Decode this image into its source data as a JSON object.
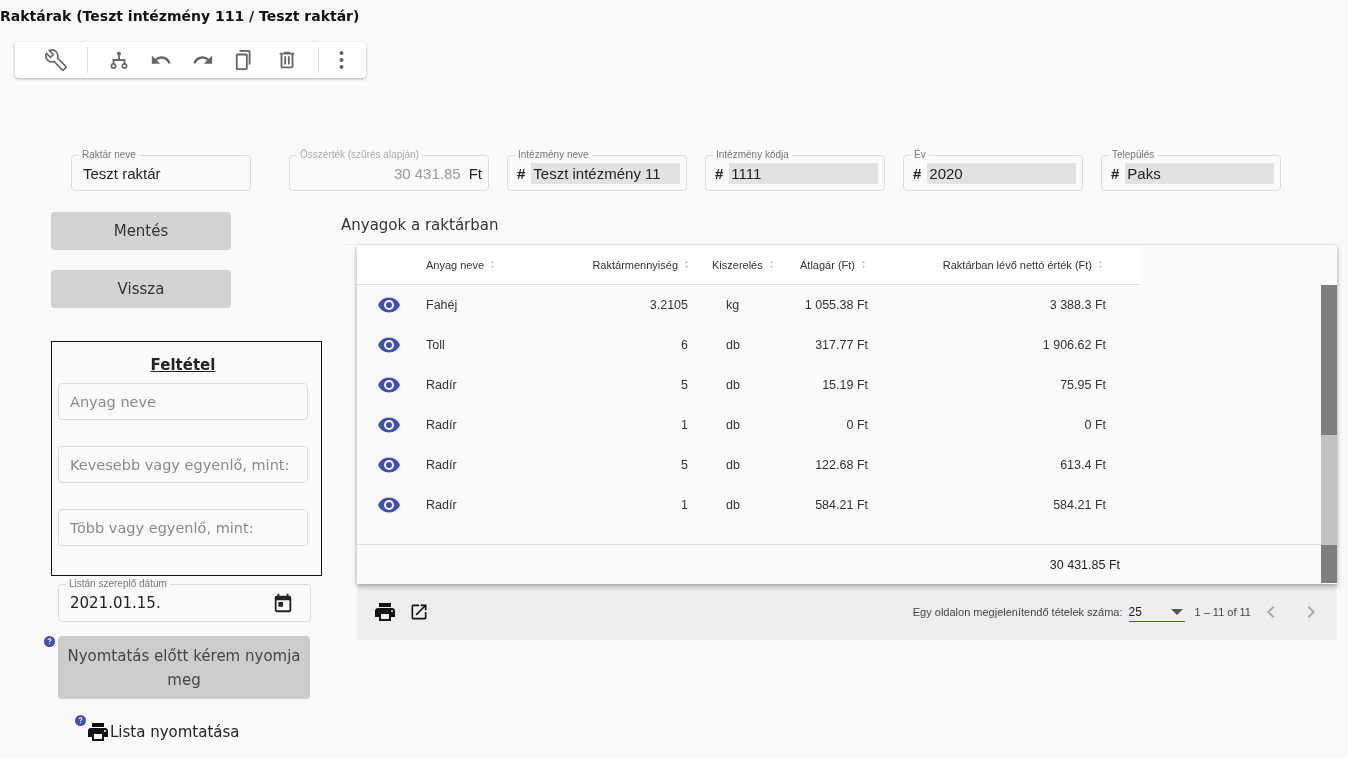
{
  "title": "Raktárak (Teszt intézmény 111 / Teszt raktár)",
  "fields": [
    {
      "kind": "text",
      "label": "Raktár neve",
      "value": "Teszt raktár",
      "readonly": false,
      "disabled": false
    },
    {
      "kind": "total",
      "label": "Összérték (szűrés alapján)",
      "value": "30 431.85",
      "suffix": "Ft",
      "readonly": false,
      "disabled": true
    },
    {
      "kind": "text",
      "label": "Intézmény neve",
      "prefix": "#",
      "value": "Teszt intézmény 11",
      "readonly": true,
      "disabled": false
    },
    {
      "kind": "text",
      "label": "Intézmény kódja",
      "prefix": "#",
      "value": "1111",
      "readonly": true,
      "disabled": false
    },
    {
      "kind": "text",
      "label": "Év",
      "prefix": "#",
      "value": "2020",
      "readonly": true,
      "disabled": false
    },
    {
      "kind": "text",
      "label": "Település",
      "prefix": "#",
      "value": "Paks",
      "readonly": true,
      "disabled": false
    }
  ],
  "buttons": [
    {
      "label": "Mentés"
    },
    {
      "label": "Vissza"
    }
  ],
  "filter": {
    "title": "Feltétel",
    "fields": [
      {
        "placeholder": "Anyag neve"
      },
      {
        "placeholder": "Kevesebb vagy egyenlő, mint:"
      },
      {
        "placeholder": "Több vagy egyenlő, mint:"
      }
    ]
  },
  "date_field": {
    "label": "Listán szereplő dátum",
    "value": "2021.01.15."
  },
  "print_prepare_button": {
    "label": "Nyomtatás előtt kérem nyomja meg"
  },
  "print_list_link": {
    "label": "Lista nyomtatása"
  },
  "table": {
    "heading": "Anyagok a raktárban",
    "columns": [
      {
        "label": "Anyag neve"
      },
      {
        "label": "Raktármennyiség"
      },
      {
        "label": "Kiszerelés"
      },
      {
        "label": "Átlagár (Ft)"
      },
      {
        "label": "Raktárban lévő nettó érték (Ft)"
      }
    ],
    "rows": [
      {
        "cells": [
          "Fahéj",
          "3.2105",
          "kg",
          "1 055.38 Ft",
          "3 388.3 Ft"
        ]
      },
      {
        "cells": [
          "Toll",
          "6",
          "db",
          "317.77 Ft",
          "1 906.62 Ft"
        ]
      },
      {
        "cells": [
          "Radír",
          "5",
          "db",
          "15.19 Ft",
          "75.95 Ft"
        ]
      },
      {
        "cells": [
          "Radír",
          "1",
          "db",
          "0 Ft",
          "0 Ft"
        ]
      },
      {
        "cells": [
          "Radír",
          "5",
          "db",
          "122.68 Ft",
          "613.4 Ft"
        ]
      },
      {
        "cells": [
          "Radír",
          "1",
          "db",
          "584.21 Ft",
          "584.21 Ft"
        ]
      }
    ],
    "total": "30 431.85 Ft"
  },
  "paginator": {
    "label": "Egy oldalon megjelenítendő tételek száma:",
    "page_size": "25",
    "range": "1 – 11 of 11"
  }
}
